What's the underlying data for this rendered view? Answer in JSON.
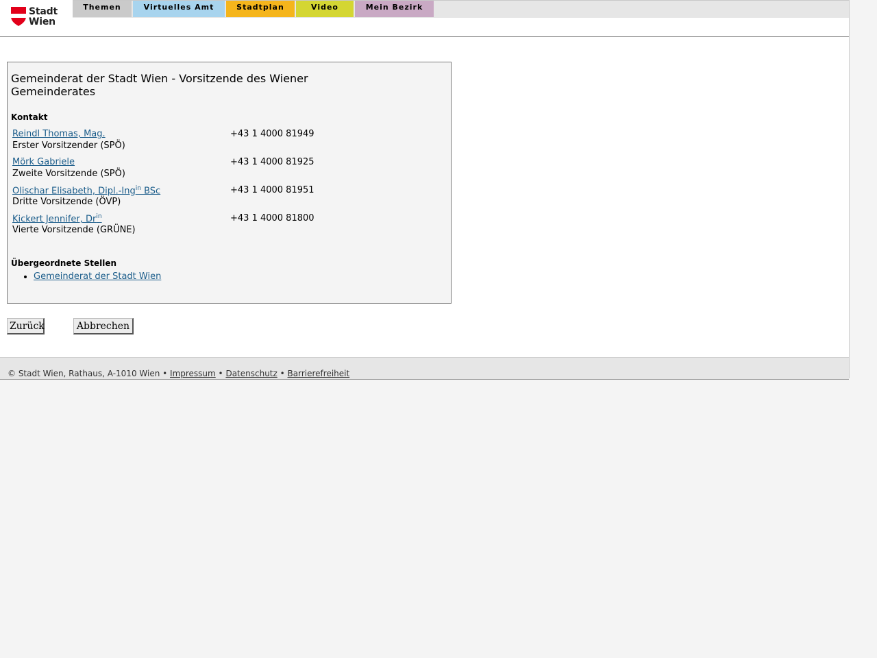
{
  "header": {
    "logo_line1": "Stadt",
    "logo_line2": "Wien",
    "nav": [
      {
        "label": "Themen",
        "color": "#cacaca"
      },
      {
        "label": "Virtuelles Amt",
        "color": "#a8d4ee"
      },
      {
        "label": "Stadtplan",
        "color": "#f5b51c"
      },
      {
        "label": "Video",
        "color": "#d4d633"
      },
      {
        "label": "Mein Bezirk",
        "color": "#c9a9c4"
      }
    ]
  },
  "main": {
    "title": "Gemeinderat der Stadt Wien - Vorsitzende des Wiener Gemeinderates",
    "contact_heading": "Kontakt",
    "contacts": [
      {
        "name": "Reindl Thomas, Mag.",
        "name_sup": "",
        "name_suffix": "",
        "role": "Erster Vorsitzender (SPÖ)",
        "phone": "+43 1 4000 81949"
      },
      {
        "name": "Mörk Gabriele",
        "name_sup": "",
        "name_suffix": "",
        "role": "Zweite Vorsitzende (SPÖ)",
        "phone": "+43 1 4000 81925"
      },
      {
        "name": "Olischar Elisabeth, Dipl.-Ing",
        "name_sup": "in",
        "name_suffix": " BSc",
        "role": "Dritte Vorsitzende (ÖVP)",
        "phone": "+43 1 4000 81951"
      },
      {
        "name": "Kickert Jennifer, Dr",
        "name_sup": "in",
        "name_suffix": "",
        "role": "Vierte Vorsitzende (GRÜNE)",
        "phone": "+43 1 4000 81800"
      }
    ],
    "parent_heading": "Übergeordnete Stellen",
    "parent_links": [
      "Gemeinderat der Stadt Wien"
    ]
  },
  "buttons": {
    "back": "Zurück",
    "cancel": "Abbrechen"
  },
  "footer": {
    "copyright": "© Stadt Wien, Rathaus, A-1010 Wien",
    "separator": " • ",
    "links": [
      "Impressum",
      "Datenschutz",
      "Barrierefreiheit"
    ]
  }
}
